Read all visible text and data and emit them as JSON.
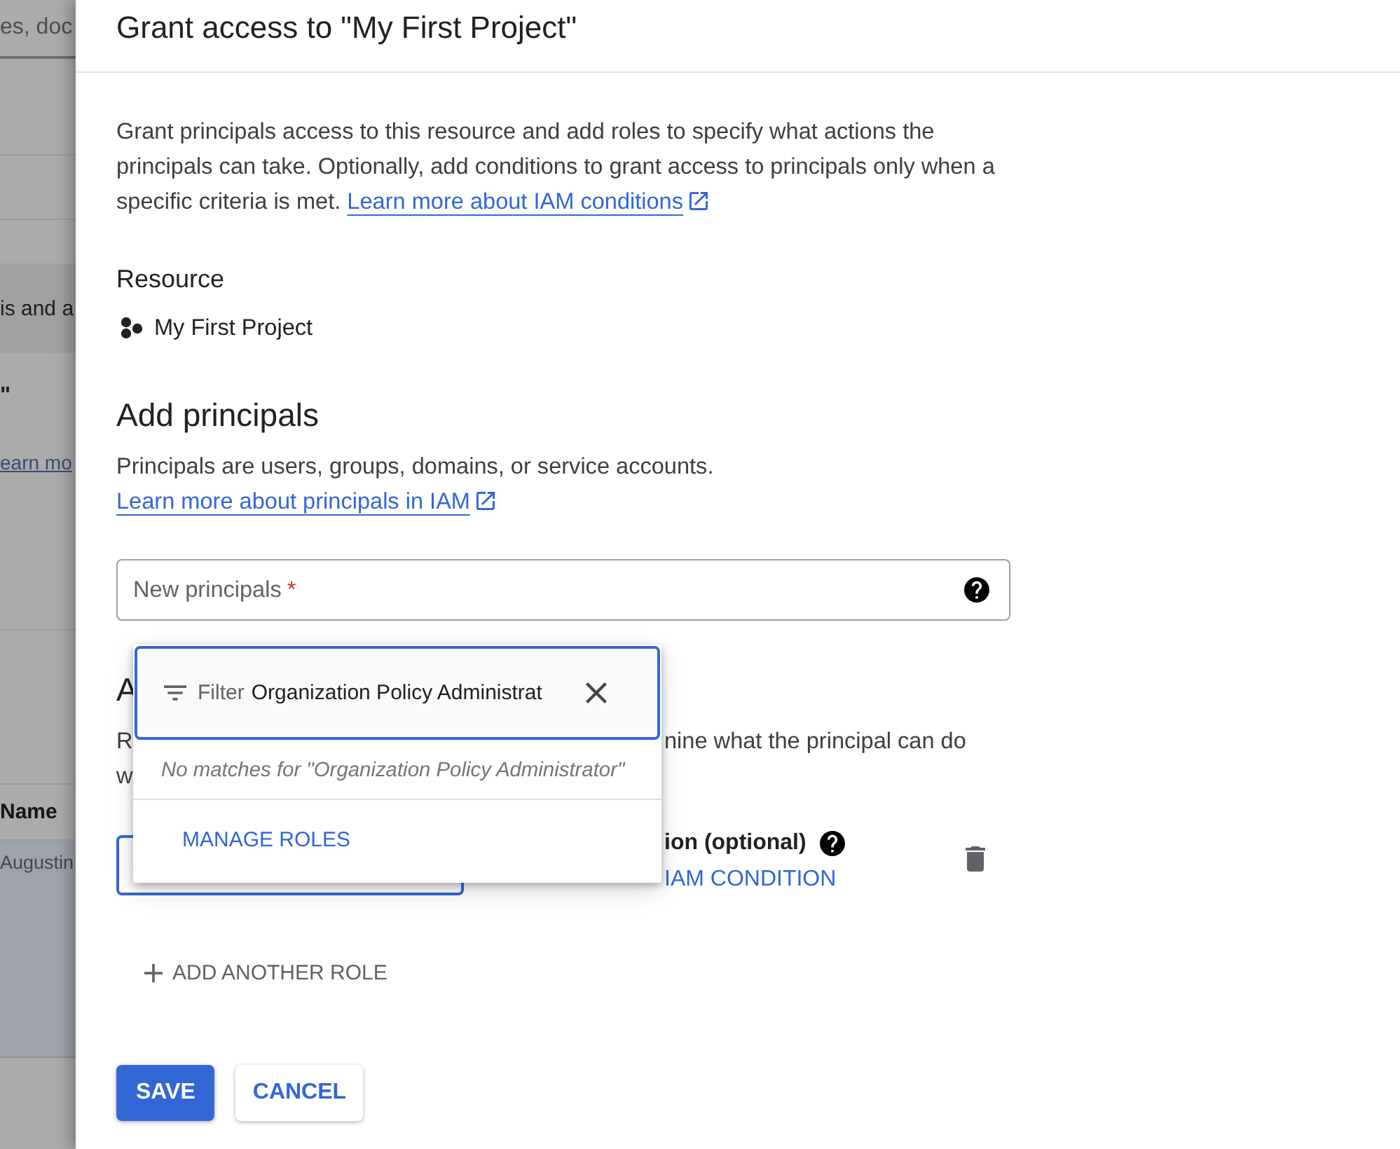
{
  "background_page": {
    "search_placeholder": "es, doc",
    "banner_text": "is and a",
    "heading_text": "\"",
    "link_text": "earn mo",
    "table": {
      "column_header": "Name",
      "cell": "Augustin"
    }
  },
  "panel": {
    "title": "Grant access to \"My First Project\"",
    "intro": {
      "text": "Grant principals access to this resource and add roles to specify what actions the principals can take. Optionally, add conditions to grant access to principals only when a specific criteria is met.",
      "link": "Learn more about IAM conditions"
    },
    "resource": {
      "heading": "Resource",
      "name": "My First Project"
    },
    "add_principals": {
      "heading": "Add principals",
      "text": "Principals are users, groups, domains, or service accounts.",
      "link": "Learn more about principals in IAM",
      "field": {
        "label": "New principals",
        "required_mark": "*"
      }
    },
    "roles": {
      "heading_fragment": "A",
      "text_fragments": [
        "R",
        "w"
      ],
      "text_right_fragment": "nine what the principal can do",
      "condition_label_fragment": "ion (optional)",
      "condition_link_fragment": "IAM CONDITION",
      "add_button": "ADD ANOTHER ROLE"
    },
    "role_dropdown": {
      "filter_label": "Filter",
      "filter_value": "Organization Policy Administrat",
      "empty_message": "No matches for \"Organization Policy Administrator\"",
      "manage_link": "MANAGE ROLES"
    },
    "buttons": [
      {
        "label": "SAVE",
        "kind": "primary"
      },
      {
        "label": "CANCEL",
        "kind": "secondary"
      }
    ]
  }
}
